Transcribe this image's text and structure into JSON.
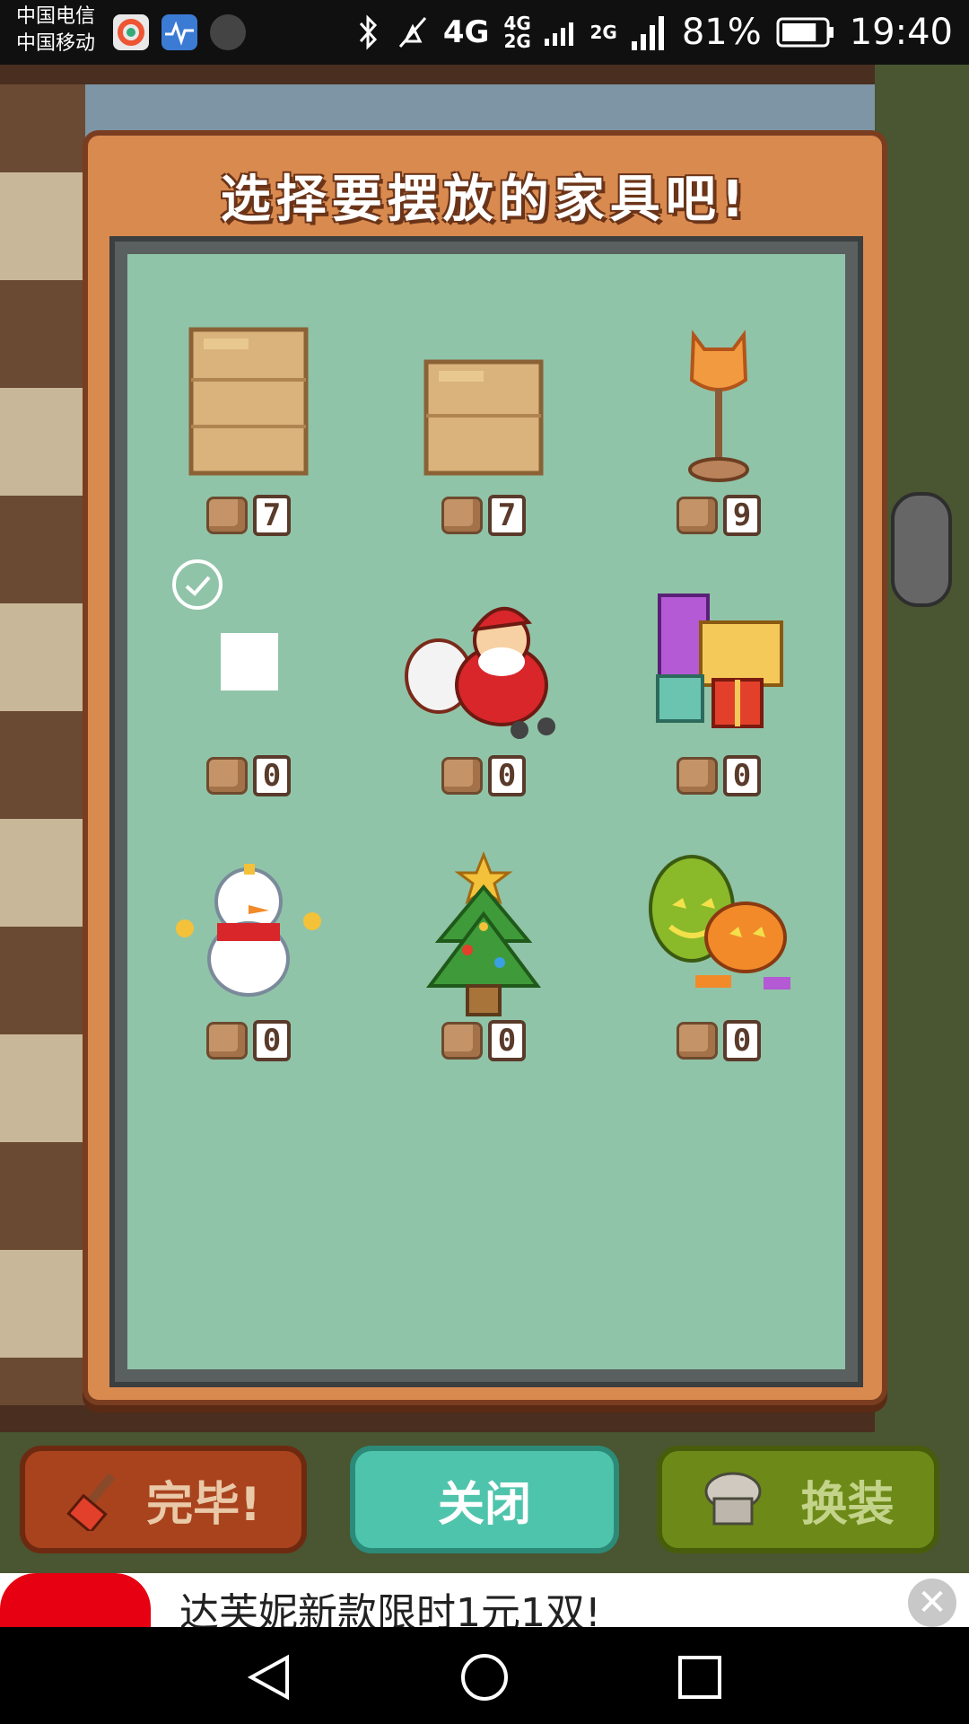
{
  "status_bar": {
    "carrier_1": "中国电信",
    "carrier_2": "中国移动",
    "icons": [
      "bluetooth-icon",
      "mute-icon",
      "signal-4g-icon",
      "signal-2g-icon",
      "battery-icon"
    ],
    "net_4g": "4G",
    "net_4g2g": "4G 2G",
    "net_2g": "2G",
    "battery": "81%",
    "battery_level": 0.81,
    "time": "19:40"
  },
  "modal": {
    "title": "选择要摆放的家具吧!",
    "items": [
      {
        "name": "cardboard-box-tall",
        "count": "7"
      },
      {
        "name": "cardboard-box-short",
        "count": "7"
      },
      {
        "name": "cat-floor-lamp",
        "count": "9"
      },
      {
        "name": "empty-selected-slot",
        "count": "0",
        "selected": true
      },
      {
        "name": "santa-claus",
        "count": "0"
      },
      {
        "name": "gift-boxes",
        "count": "0"
      },
      {
        "name": "snowman",
        "count": "0"
      },
      {
        "name": "christmas-tree",
        "count": "0"
      },
      {
        "name": "halloween-pumpkins",
        "count": "0"
      }
    ]
  },
  "buttons": {
    "done": "完毕!",
    "close": "关闭",
    "change": "换装"
  },
  "ad": {
    "text": "达芙妮新款限时1元1双!"
  },
  "colors": {
    "modal_bg": "#d98a4f",
    "grid_bg": "#90c4a8",
    "close_btn": "#4fc4ac",
    "done_btn": "#a9431e",
    "change_btn": "#6d8a18"
  }
}
